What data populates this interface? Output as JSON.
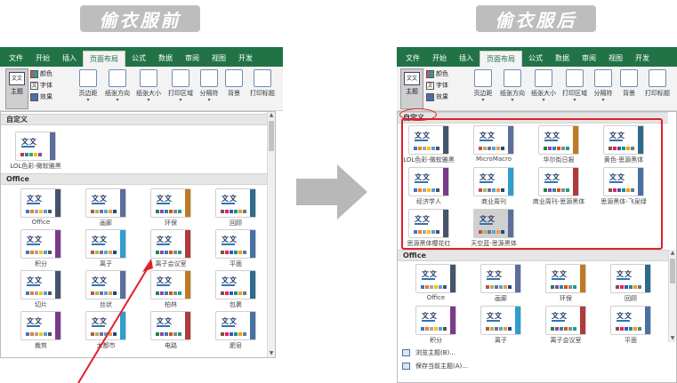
{
  "banners": {
    "before": "偷衣服前",
    "after": "偷衣服后"
  },
  "tabs_before": [
    "文件",
    "开始",
    "插入",
    "页面布局",
    "公式",
    "数据",
    "审阅",
    "视图",
    "开发"
  ],
  "tabs_after": [
    "文件",
    "开始",
    "插入",
    "页面布局",
    "公式",
    "数据",
    "审阅",
    "视图",
    "开发"
  ],
  "ribbon": {
    "theme": "主题",
    "colors": "颜色",
    "fonts": "字体",
    "effects": "效果",
    "buttons_before": [
      "页边距",
      "纸张方向",
      "纸张大小",
      "打印区域",
      "分隔符",
      "背景",
      "打印标题"
    ],
    "buttons_after": [
      "页边距",
      "纸张方向",
      "纸张大小",
      "打印区域",
      "分隔符",
      "背景",
      "打印标题"
    ]
  },
  "gallery_before": {
    "custom_header": "自定义",
    "custom_items": [
      "LOL色彩-微软雅黑"
    ],
    "office_header": "Office",
    "office_items": [
      "Office",
      "画廊",
      "环保",
      "回顾",
      "积分",
      "离子",
      "离子会议室",
      "平面",
      "切片",
      "丝状",
      "柏林",
      "包裹",
      "裁剪",
      "大都市",
      "电路",
      "肥皂"
    ]
  },
  "gallery_after": {
    "custom_header": "自定义",
    "custom_items": [
      "LOL色彩-微软雅黑",
      "MicroMacro",
      "华尔街日报",
      "黄色-思源黑体",
      "经济学人",
      "商业周刊",
      "商业周刊-思源黑体",
      "思源黑体-飞泉绿",
      "思源黑体樱花红",
      "天空蓝-思源黑体"
    ],
    "office_header": "Office",
    "office_items": [
      "Office",
      "画廊",
      "环保",
      "回顾",
      "积分",
      "离子",
      "离子会议室",
      "平面"
    ],
    "footer_browse": "浏览主题(B)...",
    "footer_save": "保存当前主题(A)..."
  },
  "thumb_text": "文文",
  "colors": {
    "excel_green": "#217346",
    "highlight_red": "#e0202a",
    "banner_gray": "#bdbdbd"
  }
}
